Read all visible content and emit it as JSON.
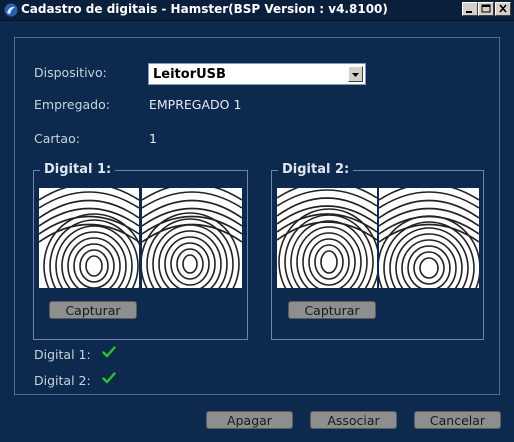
{
  "window": {
    "title": "Cadastro de digitais - Hamster(BSP Version : v4.8100)",
    "controls": [
      "minimize-icon",
      "maximize-icon",
      "close-icon"
    ]
  },
  "form": {
    "device_label": "Dispositivo:",
    "device_value": "LeitorUSB",
    "employee_label": "Empregado:",
    "employee_value": "EMPREGADO 1",
    "card_label": "Cartao:",
    "card_value": "1"
  },
  "digital1": {
    "title": "Digital 1:",
    "capture_label": "Capturar"
  },
  "digital2": {
    "title": "Digital 2:",
    "capture_label": "Capturar"
  },
  "status": {
    "digital1_label": "Digital 1:",
    "digital2_label": "Digital 2:",
    "check_icon": "check-icon",
    "check_color": "#2fbf2f"
  },
  "buttons": {
    "delete": "Apagar",
    "associate": "Associar",
    "cancel": "Cancelar"
  },
  "colors": {
    "background": "#0d2a4e",
    "titlebar": "#0a1f3b",
    "border": "#4a6fa0",
    "button": "#8e8e8e"
  }
}
